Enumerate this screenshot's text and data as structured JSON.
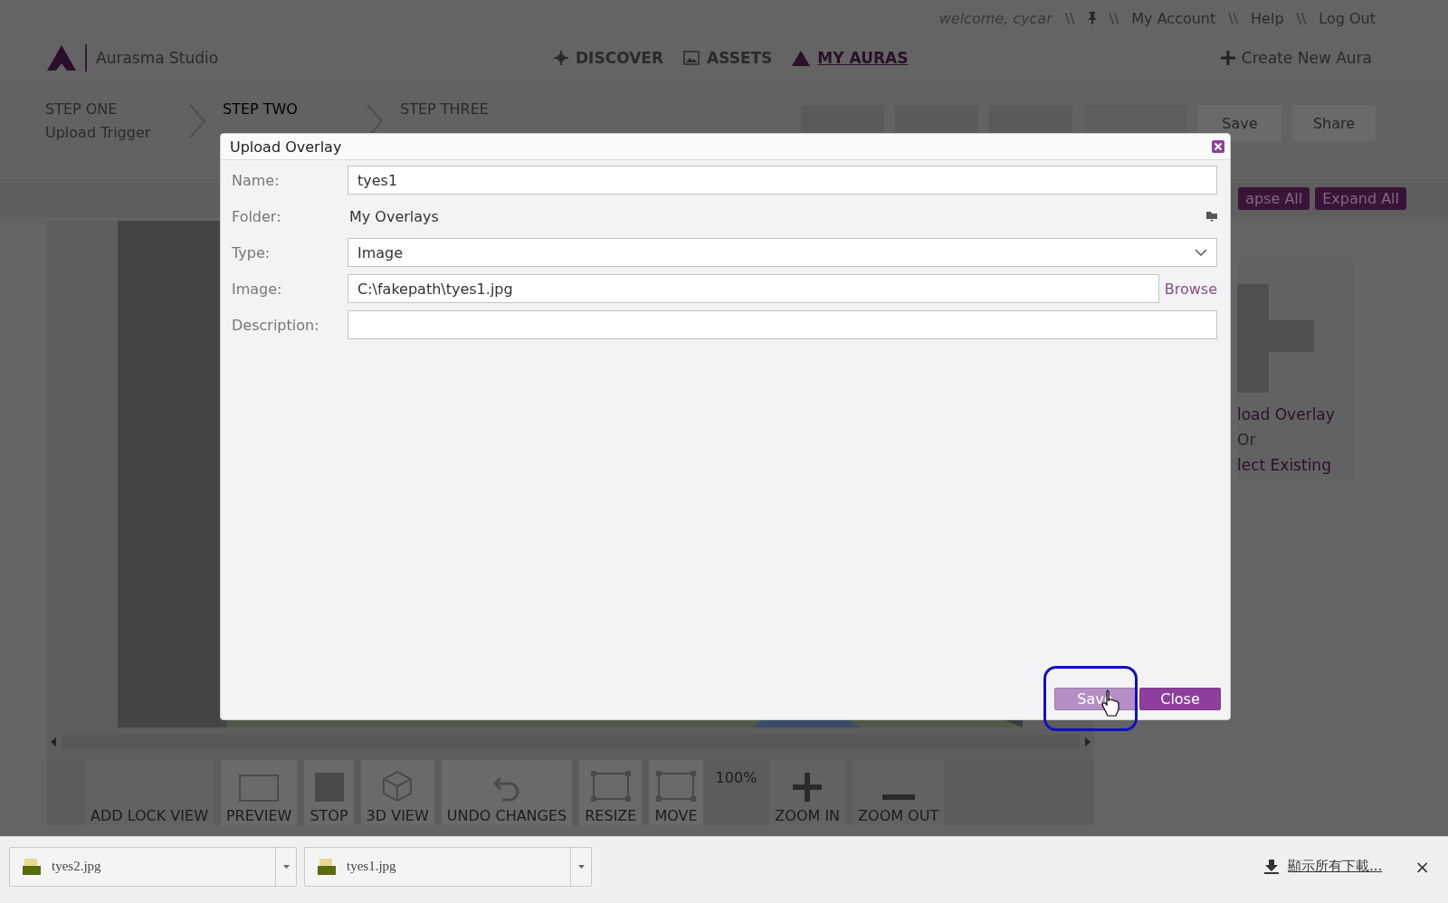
{
  "top_bar": [
    {
      "kind": "greeting",
      "text": "welcome, cycar"
    },
    {
      "kind": "separator",
      "text": "\\\\"
    },
    {
      "kind": "pin"
    },
    {
      "kind": "separator",
      "text": "\\\\"
    },
    {
      "kind": "link",
      "text": "My Account"
    },
    {
      "kind": "separator",
      "text": "\\\\"
    },
    {
      "kind": "link",
      "text": "Help"
    },
    {
      "kind": "separator",
      "text": "\\\\"
    },
    {
      "kind": "link",
      "text": "Log Out"
    }
  ],
  "header": {
    "brand": "Aurasma Studio",
    "nav": [
      {
        "kind": "discover",
        "label": "DISCOVER",
        "selected": false
      },
      {
        "kind": "assets",
        "label": "ASSETS",
        "selected": false
      },
      {
        "kind": "auras",
        "label": "MY AURAS",
        "selected": true
      }
    ],
    "create": "Create New Aura"
  },
  "steps": [
    {
      "title": "STEP ONE",
      "subtitle": "Upload Trigger",
      "selected": false
    },
    {
      "title": "STEP TWO",
      "selected": true
    },
    {
      "title": "STEP THREE",
      "selected": false
    }
  ],
  "step_actions": [
    {
      "kind": "blank"
    },
    {
      "kind": "blank"
    },
    {
      "kind": "blank"
    },
    {
      "kind": "faded"
    },
    {
      "kind": "label",
      "label": "Save"
    },
    {
      "kind": "label",
      "label": "Share"
    }
  ],
  "tree_buttons": [
    "apse All",
    "Expand All"
  ],
  "side_panel": {
    "lines": [
      "load Overlay",
      "Or",
      "lect Existing"
    ]
  },
  "toolbar": [
    {
      "kind": "lock",
      "label": "ADD LOCK VIEW"
    },
    {
      "kind": "preview",
      "label": "PREVIEW"
    },
    {
      "kind": "stop",
      "label": "STOP"
    },
    {
      "kind": "cube",
      "label": "3D VIEW"
    },
    {
      "kind": "undo",
      "label": "UNDO CHANGES"
    },
    {
      "kind": "resize",
      "label": "RESIZE"
    },
    {
      "kind": "move",
      "label": "MOVE"
    },
    {
      "kind": "zoom_level",
      "label": "100%"
    },
    {
      "kind": "zoom_in",
      "label": "ZOOM IN"
    },
    {
      "kind": "zoom_out",
      "label": "ZOOM OUT"
    }
  ],
  "dialog": {
    "title": "Upload Overlay",
    "fields": [
      {
        "kind": "text",
        "label": "Name:",
        "value": "tyes1"
      },
      {
        "kind": "folder",
        "label": "Folder:",
        "value": "My Overlays"
      },
      {
        "kind": "select",
        "label": "Type:",
        "value": "Image"
      },
      {
        "kind": "file",
        "label": "Image:",
        "value": "C:\\fakepath\\tyes1.jpg",
        "action": "Browse"
      },
      {
        "kind": "text",
        "label": "Description:"
      }
    ],
    "buttons": [
      {
        "label": "Save",
        "hovered": true,
        "highlighted": true
      },
      {
        "label": "Close",
        "hovered": false,
        "highlighted": false
      }
    ]
  },
  "downloads": {
    "files": [
      {
        "name": "tyes2.jpg"
      },
      {
        "name": "tyes1.jpg"
      }
    ],
    "show_all": "顯示所有下載...",
    "close": "×"
  }
}
